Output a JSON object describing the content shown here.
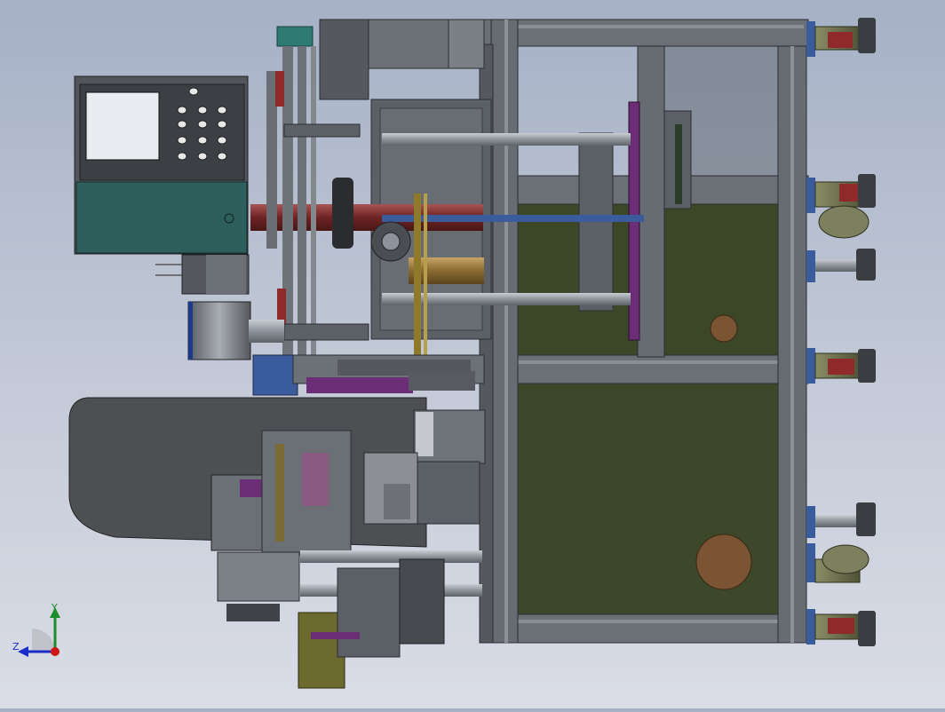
{
  "viewport": {
    "background_top": "#a6b1c6",
    "background_bottom": "#dadde6",
    "model_colors": {
      "frame": "#6b6f76",
      "frame_dark": "#3e4247",
      "panel_olive": "#3f4a28",
      "panel_teal": "#2f5f5c",
      "cabinet": "#5a5e63",
      "hopper": "#4e4f52",
      "accent_purple": "#6a2d76",
      "accent_red": "#8e2a2a",
      "bronze": "#7a5a2e",
      "copper_disc": "#7b5433",
      "rod": "#9aa0a6",
      "blue_shaft": "#3b5c9c"
    }
  },
  "triad": {
    "y_label": "Y",
    "z_label": "Z",
    "y_color": "#1d8c2a",
    "z_color": "#1a2cc8",
    "x_color": "#d01515"
  }
}
